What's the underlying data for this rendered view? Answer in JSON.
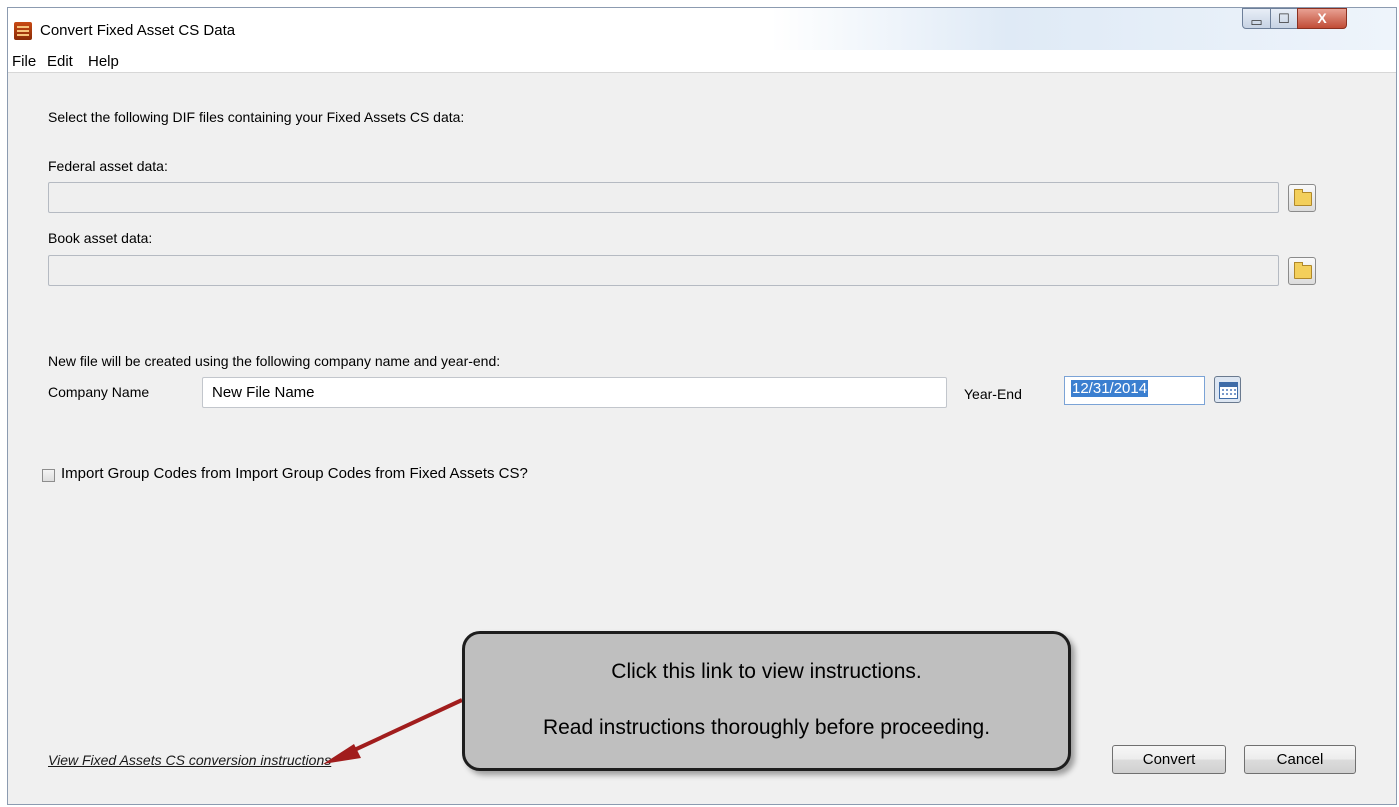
{
  "window": {
    "title": "Convert Fixed Asset CS Data",
    "controls": {
      "minimize": "▭",
      "maximize": "☐",
      "close": "X"
    }
  },
  "menu": [
    "File",
    "Edit",
    "Help"
  ],
  "form": {
    "intro": "Select the following DIF files containing your Fixed Assets CS data:",
    "federal_label": "Federal asset data:",
    "federal_value": "",
    "book_label": "Book asset data:",
    "book_value": "",
    "new_file_text": "New file will be created using the following company name and year-end:",
    "company_label": "Company Name",
    "company_value": "New File Name",
    "yearend_label": "Year-End",
    "yearend_value": "12/31/2014",
    "import_checkbox_label": "Import Group Codes from Import Group Codes from Fixed Assets CS?",
    "import_checked": false
  },
  "footer": {
    "instructions_link": "View Fixed Assets CS conversion instructions",
    "convert_button": "Convert",
    "cancel_button": "Cancel"
  },
  "callout": {
    "line1": "Click this link to view instructions.",
    "line2": "Read instructions thoroughly before proceeding."
  },
  "icons": {
    "app": "app-icon",
    "federal_browse": "folder-icon",
    "book_browse": "folder-icon",
    "date_picker": "calendar-icon"
  },
  "colors": {
    "arrow": "#a11d1d",
    "selection": "#3b7fd0",
    "callout_fill": "#bfbfbf"
  }
}
